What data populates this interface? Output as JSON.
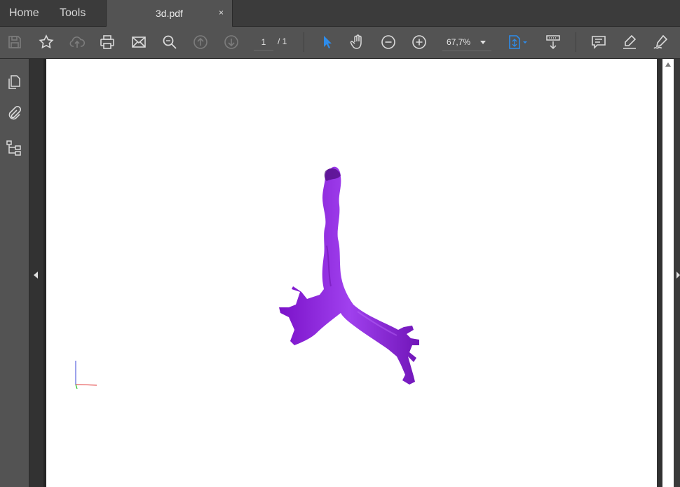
{
  "tabs": {
    "home": "Home",
    "tools": "Tools",
    "document": "3d.pdf",
    "close_glyph": "×"
  },
  "toolbar": {
    "page_current": "1",
    "page_total": "/ 1",
    "zoom": "67,7%",
    "icons": [
      "save-icon",
      "bookmark-star-icon",
      "cloud-upload-icon",
      "print-icon",
      "email-icon",
      "find-icon",
      "previous-page-icon",
      "next-page-icon",
      "select-cursor-icon",
      "hand-tool-icon",
      "zoom-out-icon",
      "zoom-in-icon",
      "fit-page-icon",
      "scroll-mode-icon",
      "comment-icon",
      "highlight-icon",
      "sign-icon"
    ],
    "accent_color": "#2d8ceb"
  },
  "left_rail": {
    "icons": [
      "page-thumbnails-icon",
      "attachments-icon",
      "structure-tree-icon"
    ]
  },
  "document": {
    "page_background": "#ffffff",
    "model_color": "#8a1fd6"
  }
}
